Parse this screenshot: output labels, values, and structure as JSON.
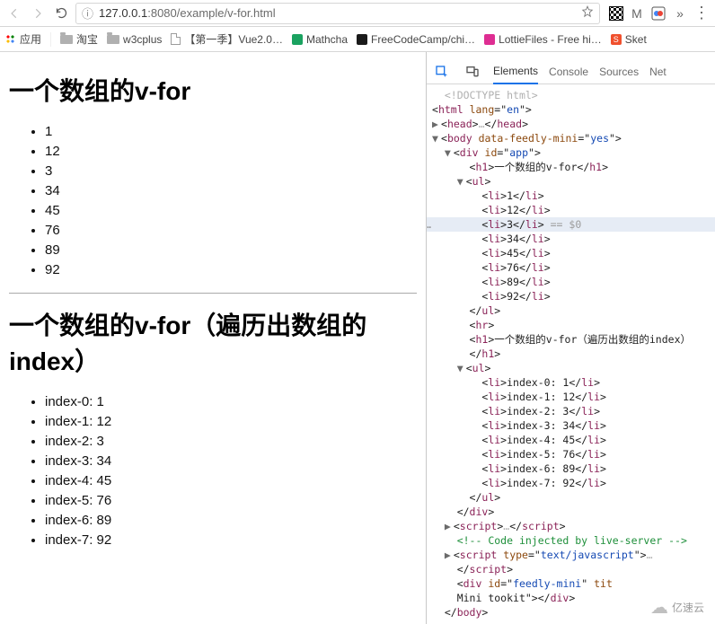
{
  "browser": {
    "url_host": "127.0.0.1",
    "url_port": ":8080",
    "url_path": "/example/v-for.html",
    "info_icon": "ⓘ"
  },
  "bookmarks": {
    "apps": "应用",
    "items": [
      {
        "label": "淘宝"
      },
      {
        "label": "w3cplus"
      },
      {
        "label": "【第一季】Vue2.0…"
      },
      {
        "label": "Mathcha"
      },
      {
        "label": "FreeCodeCamp/chi…"
      },
      {
        "label": "LottieFiles - Free hi…"
      },
      {
        "label": "Sket"
      }
    ]
  },
  "content": {
    "heading1": "一个数组的v-for",
    "heading2": "一个数组的v-for（遍历出数组的index）",
    "items": [
      "1",
      "12",
      "3",
      "34",
      "45",
      "76",
      "89",
      "92"
    ],
    "index_items": [
      "index-0: 1",
      "index-1: 12",
      "index-2: 3",
      "index-3: 34",
      "index-4: 45",
      "index-5: 76",
      "index-6: 89",
      "index-7: 92"
    ]
  },
  "devtools": {
    "tabs": {
      "elements": "Elements",
      "console": "Console",
      "sources": "Sources",
      "net": "Net"
    },
    "selected_suffix": " == $0",
    "doctype": "<!DOCTYPE html>",
    "html_lang": "en",
    "body_attr_name": "data-feedly-mini",
    "body_attr_val": "yes",
    "div_id": "app",
    "feedly_id": "feedly-mini",
    "feedly_title_attr": "tit",
    "feedly_class_text": "Mini tookit",
    "script_type": "text/javascript",
    "comment": " Code injected by live-server "
  },
  "watermark": {
    "text": "亿速云"
  }
}
